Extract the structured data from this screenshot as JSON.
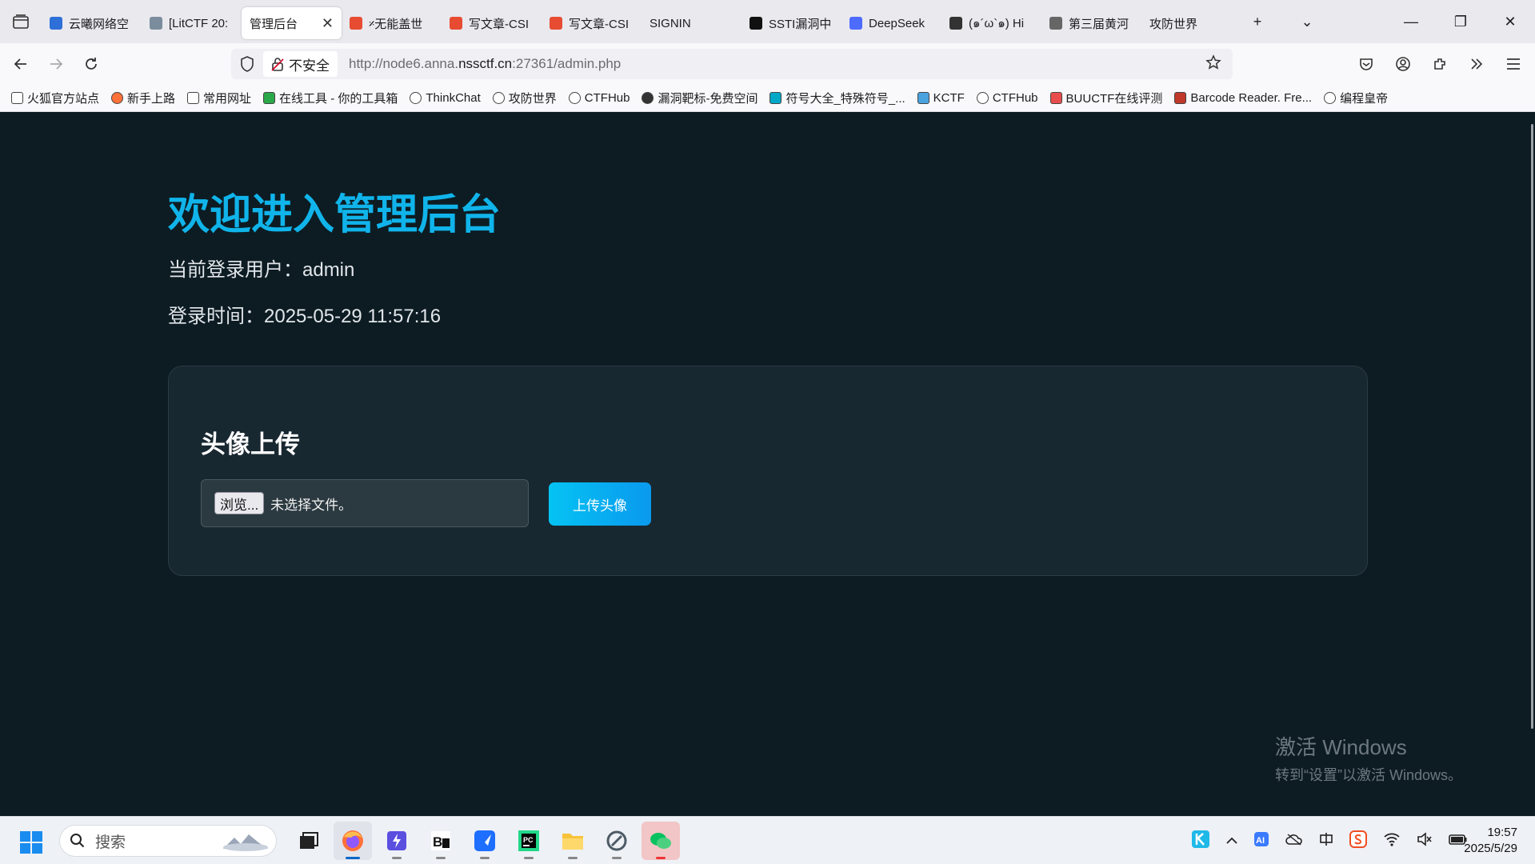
{
  "browser": {
    "tabs": [
      {
        "title": "云曦网络空",
        "color": "#2f6fd8"
      },
      {
        "title": "[LitCTF 20:",
        "color": "#7b8d9c"
      },
      {
        "title": "管理后台",
        "color": "",
        "active": true
      },
      {
        "title": "𝄎无能盖世",
        "color": "#e74c32"
      },
      {
        "title": "写文章-CSI",
        "color": "#e74c32"
      },
      {
        "title": "写文章-CSI",
        "color": "#e74c32"
      },
      {
        "title": "SIGNIN",
        "color": ""
      },
      {
        "title": "SSTI漏洞中",
        "color": "#111111"
      },
      {
        "title": "DeepSeek",
        "color": "#4d6bfe"
      },
      {
        "title": "(๑´ω`๑) Hi",
        "color": "#333333"
      },
      {
        "title": "第三届黄河",
        "color": "#666666"
      },
      {
        "title": "攻防世界",
        "color": ""
      }
    ],
    "url_security": "不安全",
    "url_prefix": "http://node6.anna.",
    "url_host": "nssctf.cn",
    "url_suffix": ":27361/admin.php",
    "bookmarks": [
      {
        "label": "火狐官方站点",
        "icon": "folder-icon"
      },
      {
        "label": "新手上路",
        "icon": "firefox-icon"
      },
      {
        "label": "常用网址",
        "icon": "folder-icon"
      },
      {
        "label": "在线工具 - 你的工具箱",
        "icon": "tool-icon"
      },
      {
        "label": "ThinkChat",
        "icon": "globe-icon"
      },
      {
        "label": "攻防世界",
        "icon": "globe-icon"
      },
      {
        "label": "CTFHub",
        "icon": "ctfhub-icon"
      },
      {
        "label": "漏洞靶标-免费空间",
        "icon": "target-icon"
      },
      {
        "label": "符号大全_特殊符号_...",
        "icon": "ke-icon"
      },
      {
        "label": "KCTF",
        "icon": "snowflake-icon"
      },
      {
        "label": "CTFHub",
        "icon": "ctfhub-icon"
      },
      {
        "label": "BUUCTF在线评测",
        "icon": "buu-icon"
      },
      {
        "label": "Barcode Reader. Fre...",
        "icon": "barcode-icon"
      },
      {
        "label": "编程皇帝",
        "icon": "globe-icon"
      }
    ]
  },
  "page": {
    "heading": "欢迎进入管理后台",
    "current_user": "当前登录用户：admin",
    "login_time": "登录时间：2025-05-29 11:57:16",
    "card_title": "头像上传",
    "browse_label": "浏览...",
    "no_file_label": "未选择文件。",
    "upload_button": "上传头像"
  },
  "watermark": {
    "title": "激活 Windows",
    "subtitle": "转到“设置”以激活 Windows。"
  },
  "taskbar": {
    "search_placeholder": "搜索",
    "time": "19:57",
    "date": "2025/5/29"
  },
  "colors": {
    "accent": "#10b4ea",
    "page_bg": "#0d1c23",
    "card_bg": "#182831"
  }
}
